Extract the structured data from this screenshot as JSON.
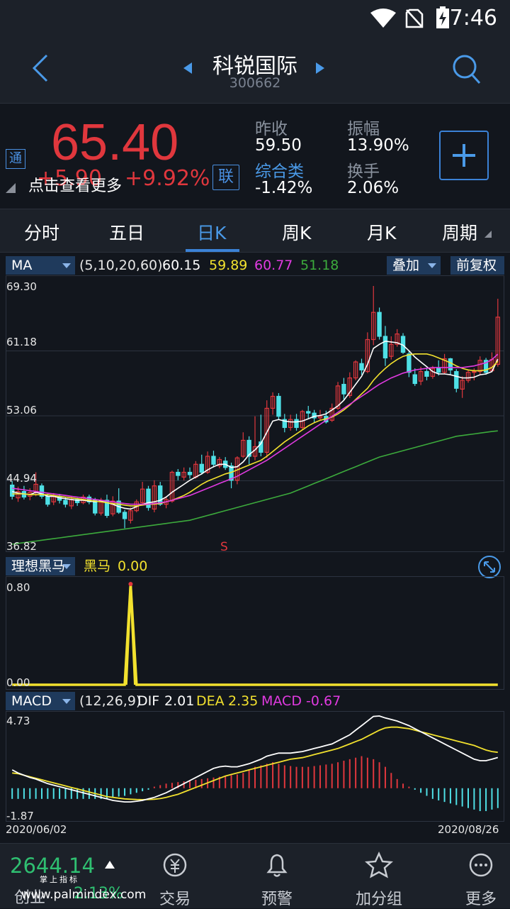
{
  "status": {
    "time": "7:46"
  },
  "header": {
    "title": "科锐国际",
    "code": "300662"
  },
  "quote": {
    "price": "65.40",
    "change": "+5.90",
    "change_pct": "+9.92%",
    "hint": "点击查看更多",
    "tong_label": "通",
    "lian_label": "联",
    "stats": {
      "prev_close_label": "昨收",
      "prev_close": "59.50",
      "amplitude_label": "振幅",
      "amplitude": "13.90%",
      "sector_label": "综合类",
      "sector": "-1.42%",
      "turnover_label": "换手",
      "turnover": "2.06%"
    }
  },
  "tabs": [
    "分时",
    "五日",
    "日K",
    "周K",
    "月K",
    "周期"
  ],
  "active_tab": "日K",
  "ma": {
    "selector": "MA",
    "params": "(5,10,20,60)",
    "v5": "60.15",
    "v10": "59.89",
    "v20": "60.77",
    "v60": "51.18",
    "overlay": "叠加",
    "adjust": "前复权",
    "axis": [
      "69.30",
      "61.18",
      "53.06",
      "44.94",
      "36.82"
    ],
    "signal": "S"
  },
  "heima": {
    "selector": "理想黑马",
    "label": "黑马",
    "value": "0.00",
    "axis_top": "0.80",
    "axis_bottom": "0.00"
  },
  "macd": {
    "selector": "MACD",
    "params": "(12,26,9)",
    "dif_label": "DIF",
    "dif": "2.01",
    "dea_label": "DEA",
    "dea": "2.35",
    "macd_label": "MACD",
    "macd": "-0.67",
    "axis_top": "4.73",
    "axis_bottom": "-1.87",
    "date_start": "2020/06/02",
    "date_end": "2020/08/26"
  },
  "bottom": {
    "index_value": "2644.14",
    "index_name": "创业",
    "index_pct": "2.13%",
    "watermark_top": "掌上指标",
    "watermark": "www.palmindex.com",
    "items": [
      "交易",
      "预警",
      "加分组",
      "更多"
    ]
  },
  "colors": {
    "up": "#e0373d",
    "down": "#4fe0e6",
    "ma5": "#ffffff",
    "ma10": "#f2e12e",
    "ma20": "#e03ae0",
    "ma60": "#3caa3c",
    "accent": "#3b82d6"
  },
  "chart_data": {
    "type": "candlestick",
    "x_range": [
      "2020/06/02",
      "2020/08/26"
    ],
    "ylim": [
      36.82,
      69.3
    ],
    "candles": [
      [
        44.4,
        43.0,
        44.9,
        42.6
      ],
      [
        42.8,
        43.6,
        44.2,
        42.3
      ],
      [
        43.6,
        42.9,
        44.3,
        42.6
      ],
      [
        43.0,
        43.5,
        44.0,
        42.5
      ],
      [
        43.5,
        44.5,
        46.0,
        43.0
      ],
      [
        44.3,
        43.0,
        44.6,
        42.7
      ],
      [
        43.0,
        42.0,
        43.3,
        41.7
      ],
      [
        42.3,
        43.0,
        43.4,
        41.9
      ],
      [
        43.0,
        42.5,
        43.3,
        42.1
      ],
      [
        42.5,
        42.0,
        42.9,
        41.6
      ],
      [
        41.8,
        42.6,
        43.0,
        41.4
      ],
      [
        42.6,
        42.2,
        42.8,
        41.8
      ],
      [
        42.2,
        42.9,
        43.2,
        42.0
      ],
      [
        42.9,
        42.3,
        43.2,
        42.0
      ],
      [
        42.5,
        40.9,
        42.8,
        40.6
      ],
      [
        40.9,
        42.5,
        42.8,
        40.6
      ],
      [
        42.5,
        40.6,
        43.2,
        40.3
      ],
      [
        40.8,
        42.4,
        43.0,
        40.5
      ],
      [
        42.4,
        41.0,
        44.0,
        40.8
      ],
      [
        41.0,
        40.2,
        41.3,
        39.0
      ],
      [
        40.0,
        41.2,
        41.6,
        39.6
      ],
      [
        41.2,
        42.3,
        42.6,
        41.0
      ],
      [
        42.2,
        43.9,
        44.8,
        42.0
      ],
      [
        43.9,
        41.6,
        44.3,
        41.2
      ],
      [
        41.4,
        44.3,
        45.0,
        41.0
      ],
      [
        44.3,
        42.0,
        44.8,
        41.8
      ],
      [
        42.0,
        42.6,
        43.0,
        41.5
      ],
      [
        42.4,
        46.0,
        46.2,
        42.2
      ],
      [
        46.0,
        45.6,
        46.4,
        45.0
      ],
      [
        45.4,
        46.0,
        46.6,
        45.0
      ],
      [
        46.0,
        45.7,
        46.6,
        45.2
      ],
      [
        45.4,
        47.0,
        47.4,
        45.2
      ],
      [
        47.0,
        46.0,
        48.2,
        45.7
      ],
      [
        46.0,
        48.0,
        48.6,
        45.8
      ],
      [
        48.0,
        47.0,
        48.7,
        46.6
      ],
      [
        46.8,
        47.6,
        47.9,
        46.5
      ],
      [
        47.4,
        46.6,
        47.9,
        46.3
      ],
      [
        46.8,
        45.0,
        47.2,
        44.0
      ],
      [
        45.0,
        47.8,
        48.0,
        44.5
      ],
      [
        48.0,
        50.0,
        51.0,
        47.8
      ],
      [
        50.0,
        48.0,
        50.5,
        47.0
      ],
      [
        48.0,
        49.2,
        53.0,
        47.5
      ],
      [
        49.8,
        48.5,
        53.2,
        48.0
      ],
      [
        48.5,
        54.0,
        55.0,
        47.8
      ],
      [
        54.0,
        55.5,
        56.0,
        53.2
      ],
      [
        55.5,
        53.0,
        55.9,
        52.6
      ],
      [
        52.6,
        51.6,
        53.3,
        51.0
      ],
      [
        51.6,
        52.6,
        53.2,
        51.2
      ],
      [
        52.6,
        51.6,
        53.3,
        51.2
      ],
      [
        51.6,
        53.6,
        53.8,
        51.4
      ],
      [
        53.6,
        53.4,
        54.3,
        52.7
      ],
      [
        53.4,
        52.8,
        53.8,
        52.2
      ],
      [
        52.8,
        53.0,
        53.8,
        52.5
      ],
      [
        53.0,
        52.3,
        53.7,
        52.1
      ],
      [
        52.5,
        54.0,
        54.6,
        52.3
      ],
      [
        54.0,
        56.8,
        57.3,
        53.8
      ],
      [
        57.0,
        55.8,
        57.8,
        55.1
      ],
      [
        55.6,
        57.8,
        58.5,
        55.3
      ],
      [
        57.8,
        59.8,
        60.0,
        57.5
      ],
      [
        59.6,
        58.8,
        60.2,
        58.2
      ],
      [
        58.6,
        62.6,
        63.5,
        58.4
      ],
      [
        62.6,
        66.0,
        69.3,
        61.9
      ],
      [
        66.0,
        63.0,
        66.6,
        62.6
      ],
      [
        63.0,
        60.3,
        64.3,
        59.3
      ],
      [
        60.5,
        62.0,
        63.0,
        60.1
      ],
      [
        62.0,
        63.3,
        63.9,
        61.7
      ],
      [
        63.0,
        61.0,
        63.4,
        60.8
      ],
      [
        60.8,
        58.5,
        61.2,
        57.9
      ],
      [
        58.2,
        57.1,
        59.0,
        56.8
      ],
      [
        57.4,
        58.6,
        59.2,
        56.9
      ],
      [
        58.6,
        58.0,
        59.0,
        57.5
      ],
      [
        58.0,
        59.0,
        59.3,
        57.7
      ],
      [
        59.0,
        58.5,
        60.0,
        58.1
      ],
      [
        58.5,
        60.2,
        60.8,
        58.3
      ],
      [
        60.2,
        58.8,
        60.3,
        58.2
      ],
      [
        58.6,
        56.5,
        58.9,
        56.0
      ],
      [
        56.4,
        57.5,
        58.0,
        55.3
      ],
      [
        57.5,
        58.5,
        58.8,
        57.2
      ],
      [
        58.5,
        58.6,
        59.0,
        57.5
      ],
      [
        58.6,
        60.0,
        60.5,
        58.2
      ],
      [
        60.0,
        58.5,
        60.3,
        58.2
      ],
      [
        58.7,
        60.1,
        61.0,
        58.5
      ],
      [
        59.5,
        65.4,
        67.7,
        59.2
      ]
    ],
    "ma_series": [
      {
        "name": "MA5",
        "values": [
          43.6,
          43.4,
          43.3,
          43.2,
          43.5,
          43.3,
          43.0,
          43.0,
          42.8,
          42.7,
          42.6,
          42.5,
          42.5,
          42.4,
          42.3,
          42.4,
          42.2,
          42.0,
          41.7,
          41.5,
          41.4,
          41.7,
          42.0,
          42.2,
          42.3,
          42.5,
          42.9,
          43.5,
          44.0,
          44.5,
          45.0,
          45.4,
          45.8,
          46.3,
          46.7,
          47.0,
          47.0,
          46.6,
          46.7,
          47.3,
          48.2,
          48.8,
          49.6,
          51.0,
          52.4,
          52.6,
          52.4,
          52.3,
          52.3,
          52.4,
          52.7,
          53.0,
          53.1,
          53.3,
          53.8,
          54.3,
          55.0,
          56.0,
          57.0,
          58.0,
          59.5,
          61.5,
          62.0,
          62.4,
          62.3,
          62.2,
          61.9,
          61.2,
          60.4,
          59.8,
          59.2,
          58.6,
          58.3,
          58.3,
          58.2,
          58.0,
          57.8,
          57.8,
          57.9,
          58.2,
          58.3,
          58.6,
          60.15
        ]
      },
      {
        "name": "MA10",
        "values": [
          43.3,
          43.3,
          43.3,
          43.2,
          43.2,
          43.2,
          43.2,
          43.1,
          43.0,
          42.9,
          42.8,
          42.7,
          42.6,
          42.5,
          42.4,
          42.3,
          42.2,
          42.1,
          42.0,
          41.9,
          41.8,
          41.8,
          41.9,
          42.0,
          42.0,
          42.1,
          42.3,
          42.5,
          42.8,
          43.1,
          43.5,
          44.0,
          44.5,
          44.9,
          45.2,
          45.5,
          45.8,
          46.0,
          46.3,
          46.6,
          46.9,
          47.2,
          47.5,
          48.0,
          48.6,
          49.2,
          49.8,
          50.3,
          50.8,
          51.3,
          51.8,
          52.2,
          52.5,
          52.7,
          52.9,
          53.3,
          53.8,
          54.4,
          55.1,
          55.8,
          56.5,
          57.5,
          58.3,
          59.0,
          59.6,
          60.1,
          60.5,
          60.7,
          60.8,
          60.8,
          60.8,
          60.6,
          60.3,
          60.0,
          59.7,
          59.3,
          59.0,
          58.8,
          58.7,
          58.7,
          58.8,
          59.1,
          59.89
        ]
      },
      {
        "name": "MA20",
        "values": [
          44.0,
          43.9,
          43.8,
          43.7,
          43.6,
          43.5,
          43.4,
          43.3,
          43.2,
          43.1,
          43.0,
          42.9,
          42.8,
          42.7,
          42.6,
          42.5,
          42.4,
          42.3,
          42.2,
          42.1,
          42.0,
          42.0,
          42.0,
          42.0,
          42.1,
          42.2,
          42.3,
          42.5,
          42.7,
          42.9,
          43.1,
          43.4,
          43.7,
          44.0,
          44.3,
          44.6,
          44.9,
          45.2,
          45.5,
          45.9,
          46.3,
          46.7,
          47.1,
          47.5,
          48.0,
          48.5,
          49.0,
          49.5,
          50.0,
          50.5,
          51.0,
          51.5,
          52.0,
          52.5,
          53.0,
          53.5,
          54.0,
          54.5,
          55.0,
          55.5,
          56.0,
          56.5,
          57.0,
          57.4,
          57.8,
          58.1,
          58.4,
          58.6,
          58.8,
          58.9,
          59.0,
          59.1,
          59.1,
          59.1,
          59.1,
          59.1,
          59.1,
          59.2,
          59.3,
          59.5,
          59.7,
          60.1,
          60.77
        ]
      },
      {
        "name": "MA60",
        "values": [
          37.0,
          37.1,
          37.2,
          37.3,
          37.4,
          37.5,
          37.6,
          37.7,
          37.8,
          37.9,
          38.0,
          38.1,
          38.2,
          38.3,
          38.4,
          38.5,
          38.6,
          38.7,
          38.8,
          38.9,
          39.0,
          39.1,
          39.2,
          39.3,
          39.4,
          39.5,
          39.6,
          39.7,
          39.8,
          39.9,
          40.0,
          40.2,
          40.4,
          40.6,
          40.8,
          41.0,
          41.2,
          41.4,
          41.6,
          41.8,
          42.0,
          42.2,
          42.4,
          42.6,
          42.8,
          43.0,
          43.2,
          43.4,
          43.7,
          44.0,
          44.3,
          44.6,
          44.9,
          45.2,
          45.5,
          45.8,
          46.1,
          46.4,
          46.7,
          47.0,
          47.3,
          47.6,
          47.9,
          48.1,
          48.3,
          48.5,
          48.7,
          48.9,
          49.1,
          49.3,
          49.5,
          49.7,
          49.9,
          50.1,
          50.3,
          50.5,
          50.6,
          50.7,
          50.8,
          50.9,
          51.0,
          51.1,
          51.18
        ]
      }
    ],
    "heima_values": {
      "peak_index": 20,
      "peak_value": 0.8,
      "others": 0.0
    },
    "macd_dif": [
      1.2,
      1.0,
      0.85,
      0.7,
      0.6,
      0.45,
      0.3,
      0.2,
      0.1,
      0.0,
      -0.1,
      -0.2,
      -0.3,
      -0.4,
      -0.5,
      -0.6,
      -0.7,
      -0.8,
      -0.85,
      -0.9,
      -0.9,
      -0.85,
      -0.8,
      -0.7,
      -0.6,
      -0.45,
      -0.3,
      -0.1,
      0.1,
      0.3,
      0.5,
      0.7,
      0.9,
      1.1,
      1.3,
      1.4,
      1.45,
      1.4,
      1.4,
      1.5,
      1.6,
      1.75,
      1.9,
      2.1,
      2.2,
      2.3,
      2.3,
      2.3,
      2.35,
      2.4,
      2.5,
      2.6,
      2.7,
      2.8,
      2.9,
      3.1,
      3.3,
      3.5,
      3.8,
      4.1,
      4.4,
      4.7,
      4.73,
      4.6,
      4.5,
      4.4,
      4.25,
      4.1,
      3.9,
      3.7,
      3.5,
      3.3,
      3.1,
      2.9,
      2.7,
      2.5,
      2.3,
      2.1,
      1.9,
      1.8,
      1.8,
      1.9,
      2.01
    ],
    "macd_dea": [
      1.0,
      0.95,
      0.85,
      0.75,
      0.65,
      0.55,
      0.45,
      0.35,
      0.25,
      0.15,
      0.05,
      -0.05,
      -0.15,
      -0.25,
      -0.35,
      -0.45,
      -0.55,
      -0.6,
      -0.65,
      -0.7,
      -0.72,
      -0.74,
      -0.75,
      -0.74,
      -0.72,
      -0.68,
      -0.6,
      -0.5,
      -0.4,
      -0.25,
      -0.1,
      0.05,
      0.2,
      0.35,
      0.5,
      0.65,
      0.8,
      0.9,
      1.0,
      1.1,
      1.2,
      1.3,
      1.4,
      1.5,
      1.6,
      1.7,
      1.8,
      1.9,
      1.95,
      2.0,
      2.1,
      2.2,
      2.3,
      2.4,
      2.5,
      2.6,
      2.75,
      2.9,
      3.05,
      3.2,
      3.4,
      3.6,
      3.8,
      3.95,
      4.0,
      4.0,
      3.95,
      3.9,
      3.8,
      3.7,
      3.6,
      3.5,
      3.4,
      3.3,
      3.2,
      3.1,
      3.0,
      2.9,
      2.8,
      2.65,
      2.5,
      2.4,
      2.35
    ],
    "macd_hist": [
      -0.7,
      -0.7,
      -0.7,
      -0.7,
      -0.7,
      -0.7,
      -0.7,
      -0.7,
      -0.7,
      -0.7,
      -0.7,
      -0.7,
      -0.7,
      -0.7,
      -0.7,
      -0.7,
      -0.7,
      -0.6,
      -0.55,
      -0.5,
      -0.4,
      -0.3,
      -0.2,
      -0.1,
      0.1,
      0.2,
      0.3,
      0.35,
      0.4,
      0.45,
      0.5,
      0.55,
      0.6,
      0.65,
      0.7,
      0.75,
      0.8,
      0.85,
      0.9,
      1.0,
      1.2,
      1.4,
      1.5,
      1.6,
      1.7,
      1.6,
      1.5,
      1.45,
      1.4,
      1.4,
      1.4,
      1.45,
      1.5,
      1.55,
      1.6,
      1.7,
      1.8,
      1.9,
      2.0,
      2.1,
      2.0,
      1.9,
      1.7,
      1.4,
      1.0,
      0.6,
      0.3,
      0.1,
      -0.1,
      -0.3,
      -0.5,
      -0.7,
      -0.8,
      -0.9,
      -1.0,
      -1.1,
      -1.2,
      -1.3,
      -1.4,
      -1.5,
      -1.5,
      -1.4,
      -1.3
    ]
  }
}
